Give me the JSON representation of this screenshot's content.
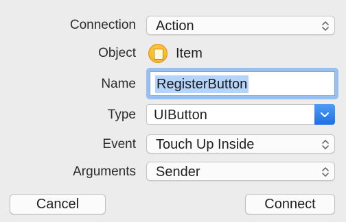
{
  "form": {
    "connection": {
      "label": "Connection",
      "value": "Action"
    },
    "object": {
      "label": "Object",
      "value": "Item",
      "icon": "object-icon"
    },
    "name": {
      "label": "Name",
      "value": "RegisterButton"
    },
    "type": {
      "label": "Type",
      "value": "UIButton"
    },
    "event": {
      "label": "Event",
      "value": "Touch Up Inside"
    },
    "arguments": {
      "label": "Arguments",
      "value": "Sender"
    }
  },
  "buttons": {
    "cancel": "Cancel",
    "connect": "Connect"
  },
  "colors": {
    "accent": "#1f6fe3",
    "focus_ring": "#98bfef",
    "selection": "#b5d4fb",
    "object_icon": "#f3a91b"
  }
}
